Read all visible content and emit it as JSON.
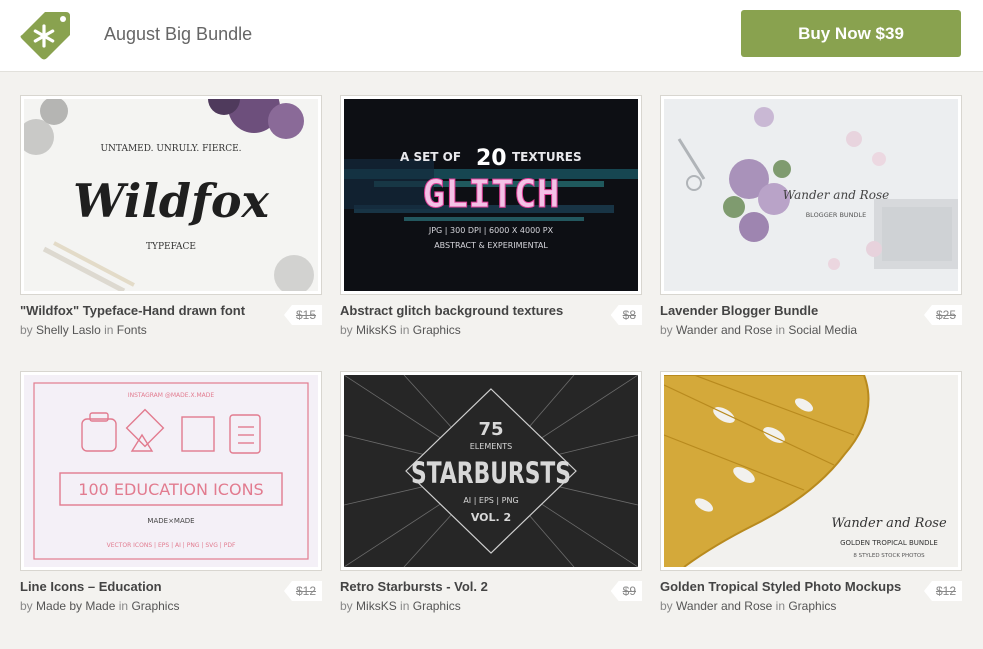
{
  "header": {
    "bundle_title": "August Big Bundle",
    "buy_button": "Buy Now $39",
    "accent_color": "#89a24f"
  },
  "products": [
    {
      "title": "\"Wildfox\" Typeface-Hand drawn font",
      "by": "by",
      "author": "Shelly Laslo",
      "in": "in",
      "category": "Fonts",
      "price": "$15",
      "thumb": {
        "line1": "UNTAMED. UNRULY. FIERCE.",
        "name": "Wildfox",
        "line2": "TYPEFACE"
      }
    },
    {
      "title": "Abstract glitch background textures",
      "by": "by",
      "author": "MiksKS",
      "in": "in",
      "category": "Graphics",
      "price": "$8",
      "thumb": {
        "line1": "A SET OF",
        "count": "20",
        "line1b": "TEXTURES",
        "name": "GLITCH",
        "line2": "JPG | 300 DPI | 6000 X 4000 PX",
        "line3": "ABSTRACT & EXPERIMENTAL"
      }
    },
    {
      "title": "Lavender Blogger Bundle",
      "by": "by",
      "author": "Wander and Rose",
      "in": "in",
      "category": "Social Media",
      "price": "$25",
      "thumb": {
        "name": "Wander and Rose",
        "line2": "BLOGGER BUNDLE"
      }
    },
    {
      "title": "Line Icons – Education",
      "by": "by",
      "author": "Made by Made",
      "in": "in",
      "category": "Graphics",
      "price": "$12",
      "thumb": {
        "line1": "INSTAGRAM @MADE.X.MADE",
        "name": "100 EDUCATION ICONS",
        "brand": "MADE×MADE",
        "line3": "VECTOR ICONS | EPS | AI | PNG | SVG | PDF"
      }
    },
    {
      "title": "Retro Starbursts - Vol. 2",
      "by": "by",
      "author": "MiksKS",
      "in": "in",
      "category": "Graphics",
      "price": "$9",
      "thumb": {
        "count": "75",
        "line1": "ELEMENTS",
        "name": "STARBURSTS",
        "line2": "AI | EPS | PNG",
        "line3": "VOL. 2"
      }
    },
    {
      "title": "Golden Tropical Styled Photo Mockups",
      "by": "by",
      "author": "Wander and Rose",
      "in": "in",
      "category": "Graphics",
      "price": "$12",
      "thumb": {
        "name": "Wander and Rose",
        "line2": "GOLDEN TROPICAL BUNDLE",
        "line3": "8 STYLED STOCK PHOTOS"
      }
    }
  ]
}
